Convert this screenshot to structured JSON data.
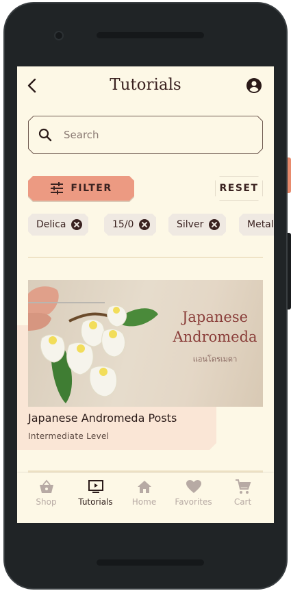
{
  "header": {
    "title": "Tutorials"
  },
  "search": {
    "placeholder": "Search"
  },
  "filter": {
    "filter_label": "FILTER",
    "reset_label": "RESET"
  },
  "chips": [
    {
      "label": "Delica"
    },
    {
      "label": "15/0"
    },
    {
      "label": "Silver"
    },
    {
      "label": "Metal"
    }
  ],
  "card": {
    "title": "Japanese Andromeda Posts",
    "subtitle": "Intermediate Level",
    "image_title_line1": "Japanese",
    "image_title_line2": "Andromeda",
    "image_caption": "แอนโดรเมดา"
  },
  "nav": {
    "items": [
      {
        "label": "Shop",
        "icon": "basket-icon"
      },
      {
        "label": "Tutorials",
        "icon": "tutorials-icon"
      },
      {
        "label": "Home",
        "icon": "home-icon"
      },
      {
        "label": "Favorites",
        "icon": "heart-icon"
      },
      {
        "label": "Cart",
        "icon": "cart-icon"
      }
    ],
    "active": "Tutorials"
  },
  "colors": {
    "background": "#fdf8e6",
    "accent": "#ec9a82",
    "text": "#3a2220",
    "inactive": "#b7aaa4"
  }
}
